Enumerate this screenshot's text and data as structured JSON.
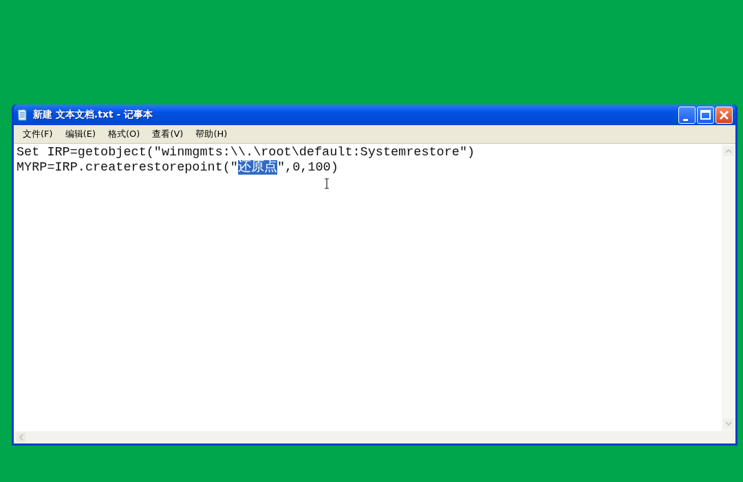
{
  "window": {
    "title": "新建 文本文档.txt - 记事本"
  },
  "menu": [
    {
      "label": "文件(F)"
    },
    {
      "label": "编辑(E)"
    },
    {
      "label": "格式(O)"
    },
    {
      "label": "查看(V)"
    },
    {
      "label": "帮助(H)"
    }
  ],
  "editor": {
    "lines": [
      {
        "segments": [
          {
            "text": "Set IRP=getobject(\"winmgmts:\\\\.\\root\\default:Systemrestore\")",
            "selected": false
          }
        ]
      },
      {
        "segments": [
          {
            "text": "MYRP=IRP.createrestorepoint(\"",
            "selected": false
          },
          {
            "text": "还原点",
            "selected": true
          },
          {
            "text": "\",0,100)",
            "selected": false
          }
        ]
      }
    ]
  }
}
